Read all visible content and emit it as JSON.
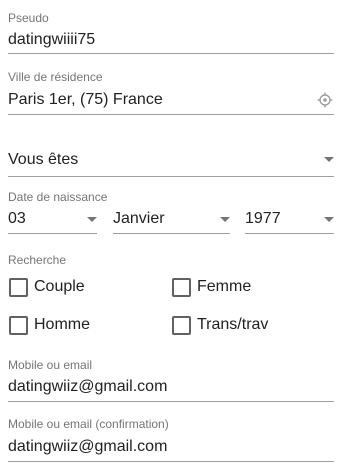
{
  "pseudo": {
    "label": "Pseudo",
    "value": "datingwiiii75"
  },
  "ville": {
    "label": "Ville de résidence",
    "value": "Paris 1er, (75) France",
    "icon": "location-crosshair-icon"
  },
  "vous_etes": {
    "value": "Vous êtes"
  },
  "naissance": {
    "label": "Date de naissance",
    "day": "03",
    "month": "Janvier",
    "year": "1977"
  },
  "recherche": {
    "label": "Recherche",
    "options": [
      "Couple",
      "Femme",
      "Homme",
      "Trans/trav"
    ]
  },
  "mobile": {
    "label": "Mobile ou email",
    "value": "datingwiiz@gmail.com"
  },
  "mobile_confirm": {
    "label": "Mobile ou email (confirmation)",
    "value": "datingwiiz@gmail.com"
  }
}
